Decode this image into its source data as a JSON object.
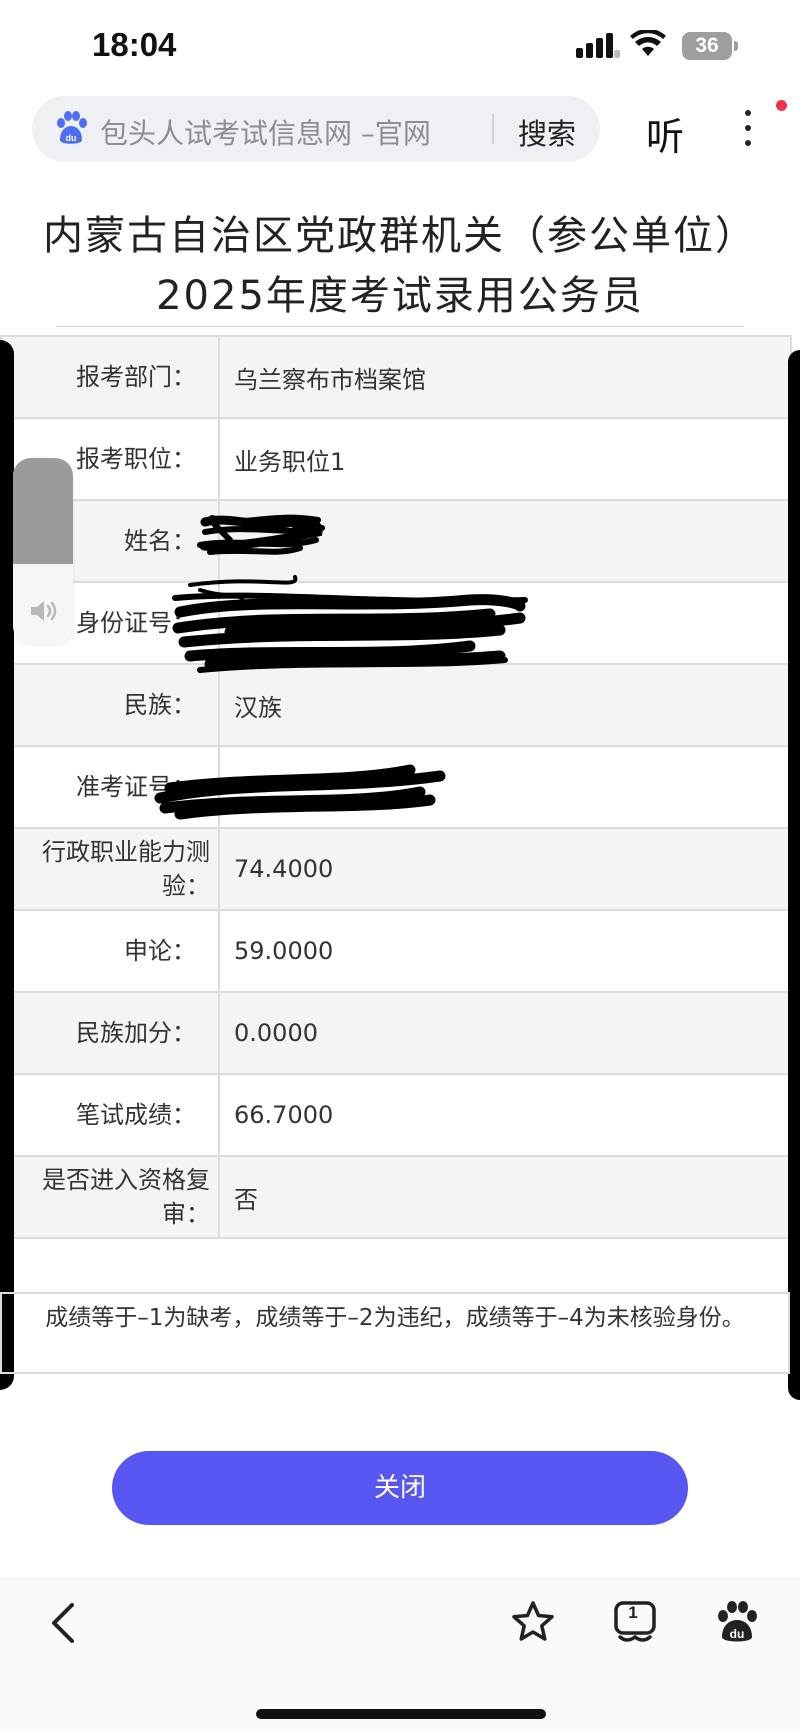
{
  "status_bar": {
    "time": "18:04",
    "battery": "36"
  },
  "browser": {
    "search_text": "包头人试考试信息网 –官网",
    "search_button": "搜索",
    "listen_button": "听"
  },
  "page": {
    "title": "内蒙古自治区党政群机关（参公单位）2025年度考试录用公务员"
  },
  "table": {
    "rows": [
      {
        "label": "报考部门：",
        "value": "乌兰察布市档案馆"
      },
      {
        "label": "报考职位：",
        "value": "业务职位1"
      },
      {
        "label": "姓名：",
        "value": ""
      },
      {
        "label": "身份证号：",
        "value": ""
      },
      {
        "label": "民族：",
        "value": "汉族"
      },
      {
        "label": "准考证号：",
        "value": ""
      },
      {
        "label": "行政职业能力测验：",
        "value": "74.4000"
      },
      {
        "label": "申论：",
        "value": "59.0000"
      },
      {
        "label": "民族加分：",
        "value": "0.0000"
      },
      {
        "label": "笔试成绩：",
        "value": "66.7000"
      },
      {
        "label": "是否进入资格复审：",
        "value": "否"
      }
    ]
  },
  "note": "成绩等于–1为缺考，成绩等于–2为违纪，成绩等于–4为未核验身份。",
  "close_button": "关闭",
  "toolbar": {
    "tabs_count": "1"
  },
  "colors": {
    "accent": "#5856f0",
    "notification_dot": "#f0324b",
    "table_stripe": "#f4f4f4",
    "table_border": "#dcdcdc"
  }
}
